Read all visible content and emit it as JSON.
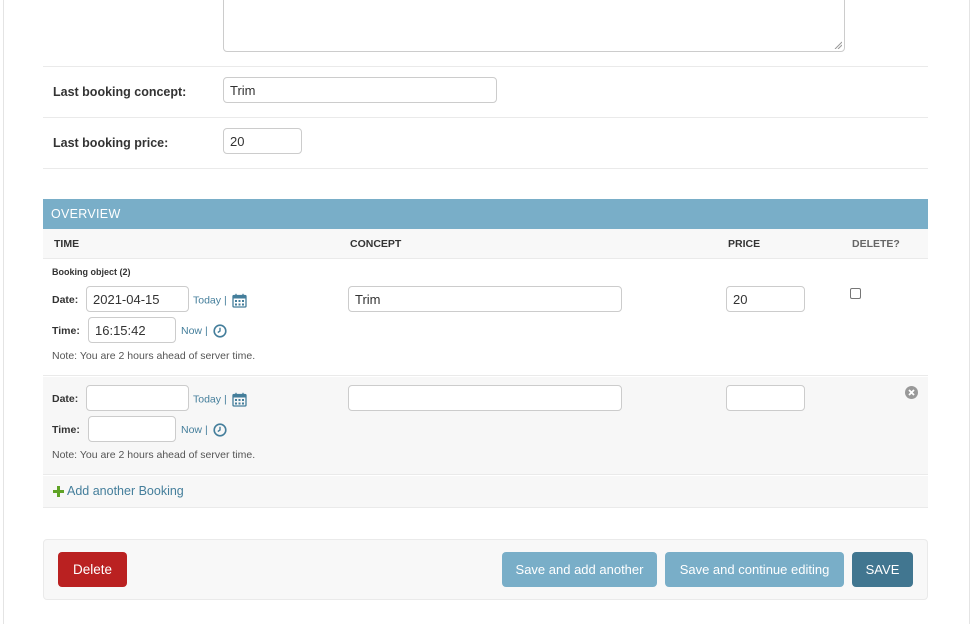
{
  "form": {
    "last_booking_concept": {
      "label": "Last booking concept:",
      "value": "Trim"
    },
    "last_booking_price": {
      "label": "Last booking price:",
      "value": "20"
    }
  },
  "overview": {
    "title": "OVERVIEW",
    "columns": {
      "time": "TIME",
      "concept": "CONCEPT",
      "price": "PRICE",
      "delete": "DELETE?"
    },
    "rows": [
      {
        "object_label": "Booking object (2)",
        "date_label": "Date:",
        "date_value": "2021-04-15",
        "today_label": "Today",
        "separator": "|",
        "time_label": "Time:",
        "time_value": "16:15:42",
        "now_label": "Now",
        "note": "Note: You are 2 hours ahead of server time.",
        "concept_value": "Trim",
        "price_value": "20"
      },
      {
        "date_label": "Date:",
        "date_value": "",
        "today_label": "Today",
        "separator": "|",
        "time_label": "Time:",
        "time_value": "",
        "now_label": "Now",
        "note": "Note: You are 2 hours ahead of server time.",
        "concept_value": "",
        "price_value": ""
      }
    ],
    "add_another": "Add another Booking"
  },
  "actions": {
    "delete": "Delete",
    "save_add_another": "Save and add another",
    "save_continue": "Save and continue editing",
    "save": "SAVE"
  },
  "icons": {
    "calendar": "calendar-icon",
    "clock": "clock-icon",
    "remove": "remove-icon",
    "add": "plus-icon"
  },
  "colors": {
    "header": "#79aec8",
    "link": "#447e9b",
    "delete": "#ba2121",
    "save": "#417690",
    "secondary_button": "#79aec8",
    "add_plus": "#5fa225"
  }
}
